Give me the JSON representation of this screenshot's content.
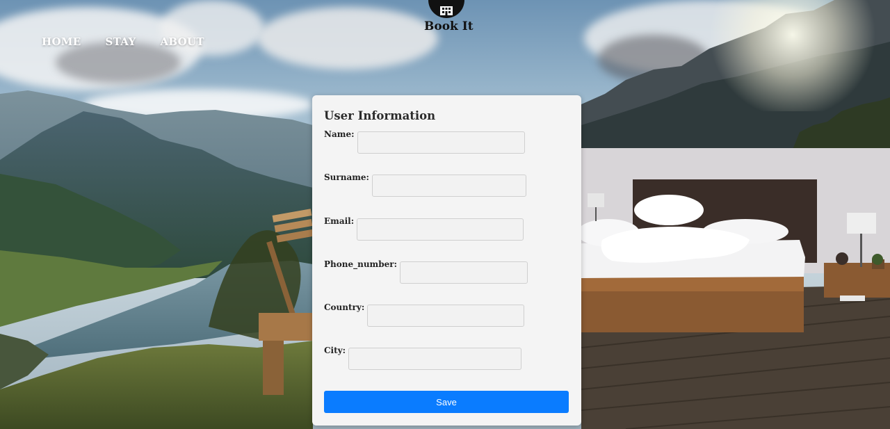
{
  "brand": {
    "name": "Book It",
    "icon": "hotel-building-icon"
  },
  "nav": {
    "items": [
      "HOME",
      "STAY",
      "ABOUT"
    ]
  },
  "form": {
    "title": "User Information",
    "fields": [
      {
        "label": "Name:",
        "value": ""
      },
      {
        "label": "Surname:",
        "value": ""
      },
      {
        "label": "Email:",
        "value": ""
      },
      {
        "label": "Phone_number:",
        "value": ""
      },
      {
        "label": "Country:",
        "value": ""
      },
      {
        "label": "City:",
        "value": ""
      }
    ],
    "save_label": "Save"
  },
  "colors": {
    "primary": "#0a7cff",
    "card_bg": "#f4f4f4",
    "logo": "#111111"
  }
}
